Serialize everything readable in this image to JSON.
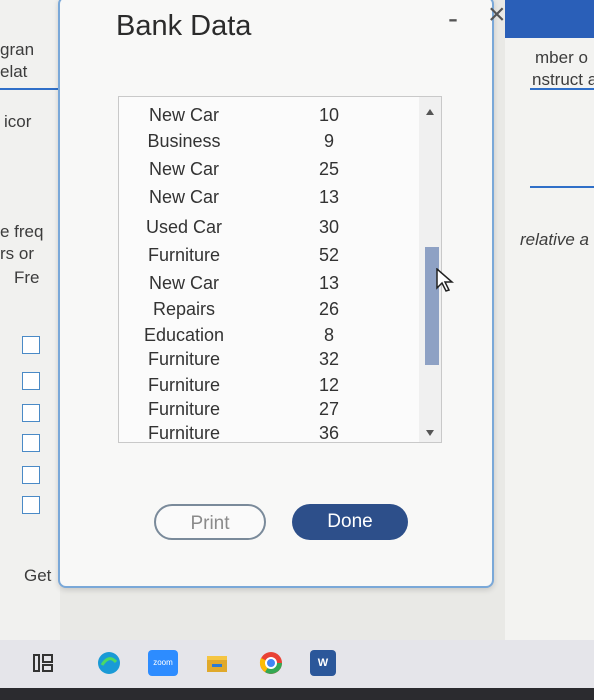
{
  "background": {
    "left_fragments": [
      "gran",
      "elat",
      "icor",
      "e freq",
      "rs or",
      "Fre",
      "Get"
    ],
    "right_fragments": [
      "mber o",
      "nstruct a",
      "relative a"
    ]
  },
  "dialog": {
    "title": "Bank Data",
    "minimize_label": "-",
    "close_label": "×",
    "rows": [
      {
        "category": "New Car",
        "value": "10"
      },
      {
        "category": "Business",
        "value": "9"
      },
      {
        "category": "New Car",
        "value": "25"
      },
      {
        "category": "New Car",
        "value": "13"
      },
      {
        "category": "Used Car",
        "value": "30"
      },
      {
        "category": "Furniture",
        "value": "52"
      },
      {
        "category": "New Car",
        "value": "13"
      },
      {
        "category": "Repairs",
        "value": "26"
      },
      {
        "category": "Education",
        "value": "8"
      },
      {
        "category": "Furniture",
        "value": "32"
      },
      {
        "category": "Furniture",
        "value": "12"
      },
      {
        "category": "Furniture",
        "value": "27"
      },
      {
        "category": "Furniture",
        "value": "36"
      }
    ],
    "print_label": "Print",
    "done_label": "Done"
  },
  "taskbar": {
    "icons": [
      "task-view-icon",
      "edge-icon",
      "zoom-icon",
      "file-explorer-icon",
      "chrome-icon",
      "word-icon"
    ],
    "zoom_label": "zoom",
    "word_label": "W"
  },
  "colors": {
    "accent": "#2d4f8a",
    "scroll_thumb": "#8ea1c4"
  }
}
